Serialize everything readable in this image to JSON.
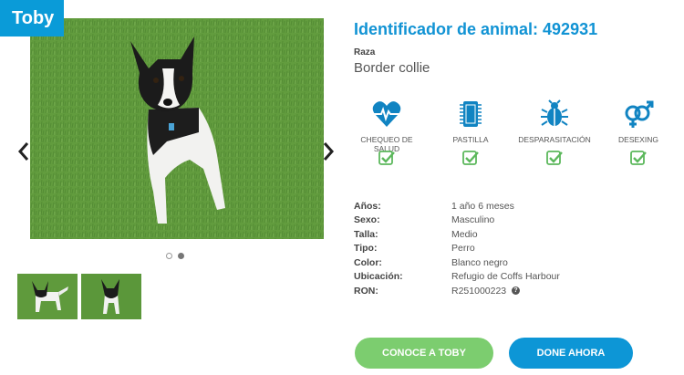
{
  "pet": {
    "name": "Toby",
    "id_title": "Identificador de animal: 492931",
    "breed_label": "Raza",
    "breed_value": "Border collie"
  },
  "care": [
    {
      "label": "CHEQUEO DE SALUD",
      "icon": "heart-pulse-icon",
      "checked": true
    },
    {
      "label": "PASTILLA",
      "icon": "microchip-icon",
      "checked": true
    },
    {
      "label": "DESPARASITACIÓN",
      "icon": "bug-icon",
      "checked": true
    },
    {
      "label": "DESEXING",
      "icon": "gender-icon",
      "checked": true
    }
  ],
  "details": [
    {
      "key": "Años:",
      "value": "1 año 6 meses"
    },
    {
      "key": "Sexo:",
      "value": "Masculino"
    },
    {
      "key": "Talla:",
      "value": "Medio"
    },
    {
      "key": "Tipo:",
      "value": "Perro"
    },
    {
      "key": "Color:",
      "value": "Blanco negro"
    },
    {
      "key": "Ubicación:",
      "value": "Refugio de Coffs Harbour"
    },
    {
      "key": "RON:",
      "value": "R251000223"
    }
  ],
  "help_glyph": "?",
  "carousel": {
    "slide_count": 2,
    "active_index": 1
  },
  "buttons": {
    "meet": "CONOCE A TOBY",
    "donate": "DONE AHORA"
  },
  "colors": {
    "accent": "#0a9bd8",
    "meet_button": "#7ccd6f",
    "donate_button": "#0d96d6",
    "check": "#5cb85c"
  }
}
